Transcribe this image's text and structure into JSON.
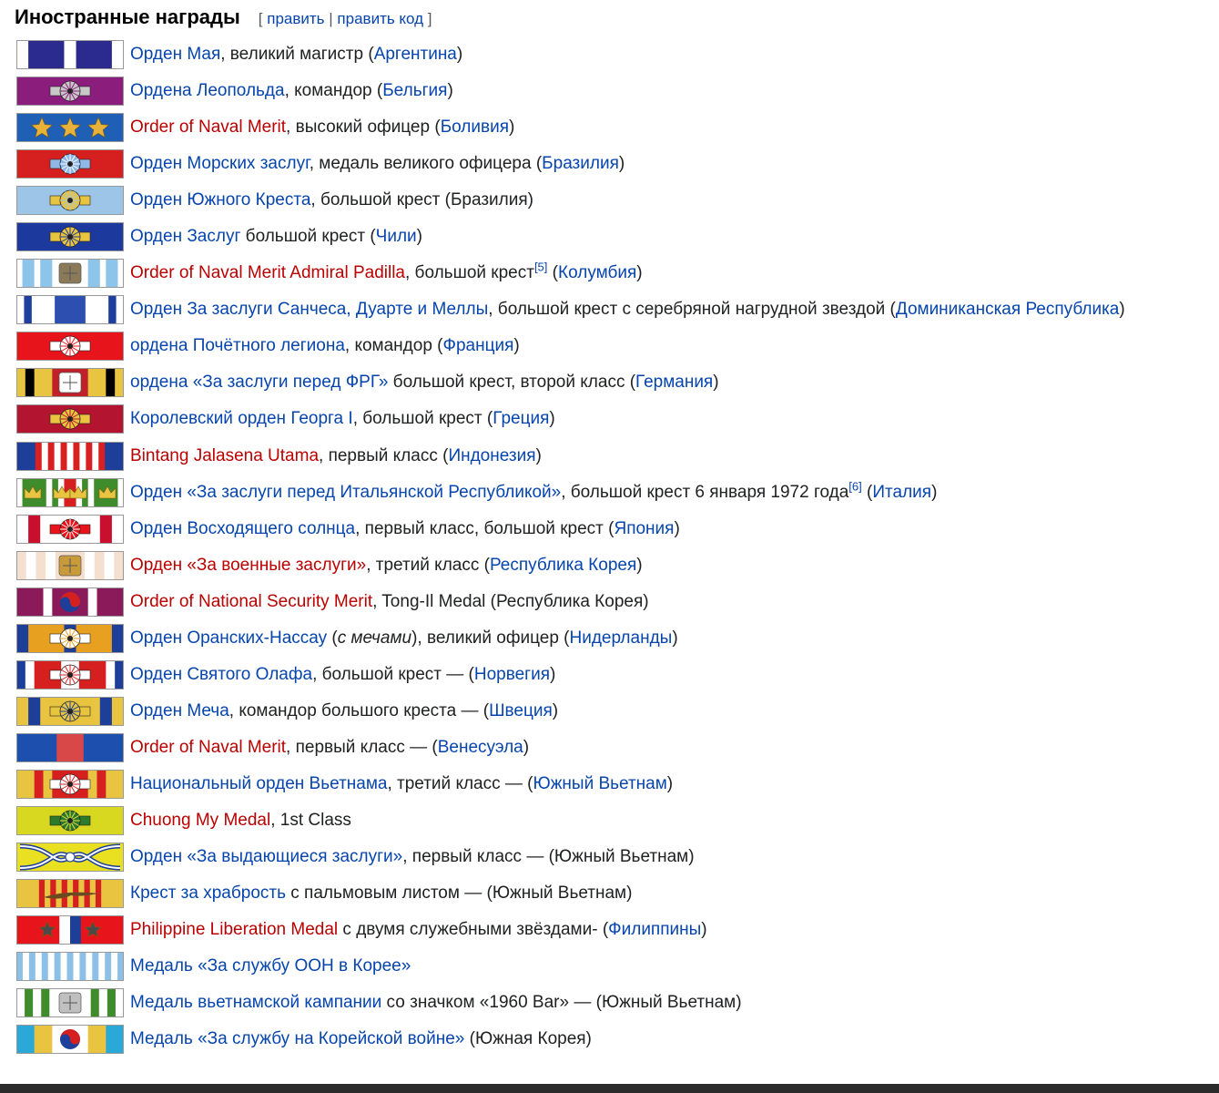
{
  "section": {
    "title": "Иностранные награды",
    "edit_open": "[",
    "edit_link": "править",
    "edit_sep": "|",
    "edit_code_link": "править код",
    "edit_close": "]"
  },
  "awards": [
    {
      "ribbon": "stripes",
      "colors": [
        "#ffffff",
        "#2b2b8f",
        "#ffffff",
        "#2b2b8f",
        "#ffffff"
      ],
      "widths": [
        1,
        3,
        1,
        3,
        1
      ],
      "parts": [
        {
          "t": "Орден Мая",
          "c": "lnk"
        },
        {
          "t": ", великий магистр (",
          "c": "txt"
        },
        {
          "t": "Аргентина",
          "c": "lnk"
        },
        {
          "t": ")",
          "c": "txt"
        }
      ]
    },
    {
      "ribbon": "rosette",
      "colors": [
        "#8b1d7d"
      ],
      "rosette": "#c8c8c8",
      "accent": "#8b1d7d",
      "parts": [
        {
          "t": "Ордена Леопольда",
          "c": "lnk"
        },
        {
          "t": ", командор (",
          "c": "txt"
        },
        {
          "t": "Бельгия",
          "c": "lnk"
        },
        {
          "t": ")",
          "c": "txt"
        }
      ]
    },
    {
      "ribbon": "stars",
      "colors": [
        "#1f5fb5"
      ],
      "star": "#e8b23a",
      "parts": [
        {
          "t": "Order of Naval Merit",
          "c": "red"
        },
        {
          "t": ", высокий офицер (",
          "c": "txt"
        },
        {
          "t": "Боливия",
          "c": "lnk"
        },
        {
          "t": ")",
          "c": "txt"
        }
      ]
    },
    {
      "ribbon": "rosette",
      "colors": [
        "#d62020"
      ],
      "rosette": "#8fb8e8",
      "accent": "#ffffff",
      "parts": [
        {
          "t": "Орден Морских заслуг",
          "c": "lnk"
        },
        {
          "t": ", медаль великого офицера (",
          "c": "txt"
        },
        {
          "t": "Бразилия",
          "c": "lnk"
        },
        {
          "t": ")",
          "c": "txt"
        }
      ]
    },
    {
      "ribbon": "rosette",
      "colors": [
        "#9cc5e8"
      ],
      "rosette": "#e8c440",
      "accent": "#9cc5e8",
      "parts": [
        {
          "t": "Орден Южного Креста",
          "c": "lnk"
        },
        {
          "t": ", большой крест (Бразилия)",
          "c": "txt"
        }
      ]
    },
    {
      "ribbon": "rosette",
      "colors": [
        "#1c3a9e"
      ],
      "rosette": "#e8c440",
      "accent": "#1c3a9e",
      "parts": [
        {
          "t": "Орден Заслуг",
          "c": "lnk"
        },
        {
          "t": " большой крест (",
          "c": "txt"
        },
        {
          "t": "Чили",
          "c": "lnk"
        },
        {
          "t": ")",
          "c": "txt"
        }
      ]
    },
    {
      "ribbon": "badge",
      "colors": [
        "#ffffff",
        "#8cc4ea",
        "#ffffff",
        "#8cc4ea",
        "#ffffff",
        "#8cc4ea",
        "#ffffff",
        "#8cc4ea",
        "#ffffff"
      ],
      "widths": [
        1,
        2,
        1,
        2,
        6,
        2,
        1,
        2,
        1
      ],
      "badge": "#8a7a5a",
      "parts": [
        {
          "t": "Order of Naval Merit Admiral Padilla",
          "c": "red"
        },
        {
          "t": ", большой крест",
          "c": "txt"
        },
        {
          "t": "[5]",
          "c": "lnk",
          "sup": true
        },
        {
          "t": " (",
          "c": "txt"
        },
        {
          "t": "Колумбия",
          "c": "lnk"
        },
        {
          "t": ")",
          "c": "txt"
        }
      ]
    },
    {
      "ribbon": "stripes",
      "colors": [
        "#ffffff",
        "#1e3f9e",
        "#ffffff",
        "#2c4fb0",
        "#ffffff",
        "#1e3f9e",
        "#ffffff"
      ],
      "widths": [
        1,
        1,
        3,
        4,
        3,
        1,
        1
      ],
      "parts": [
        {
          "t": "Орден За заслуги Санчеса, Дуарте и Меллы",
          "c": "lnk"
        },
        {
          "t": ", большой крест с серебряной нагрудной звездой (",
          "c": "txt"
        },
        {
          "t": "Доминиканская Республика",
          "c": "lnk"
        },
        {
          "t": ")",
          "c": "txt"
        }
      ]
    },
    {
      "ribbon": "rosette",
      "colors": [
        "#e8141b"
      ],
      "rosette": "#ffffff",
      "accent": "#e8141b",
      "parts": [
        {
          "t": "ордена Почётного легиона",
          "c": "lnk"
        },
        {
          "t": ", командор (",
          "c": "txt"
        },
        {
          "t": "Франция",
          "c": "lnk"
        },
        {
          "t": ")",
          "c": "txt"
        }
      ]
    },
    {
      "ribbon": "badge",
      "colors": [
        "#e8c440",
        "#000000",
        "#e8c440",
        "#c0202a",
        "#e8c440",
        "#000000",
        "#e8c440"
      ],
      "widths": [
        1,
        1,
        2,
        4,
        2,
        1,
        1
      ],
      "badge": "#ffffff",
      "parts": [
        {
          "t": "ордена «За заслуги перед ФРГ»",
          "c": "lnk"
        },
        {
          "t": " большой крест, второй класс (",
          "c": "txt"
        },
        {
          "t": "Германия",
          "c": "lnk"
        },
        {
          "t": ")",
          "c": "txt"
        }
      ]
    },
    {
      "ribbon": "rosette",
      "colors": [
        "#b3142f"
      ],
      "rosette": "#e8c440",
      "accent": "#b3142f",
      "parts": [
        {
          "t": "Королевский орден Георга I",
          "c": "lnk"
        },
        {
          "t": ", большой крест (",
          "c": "txt"
        },
        {
          "t": "Греция",
          "c": "lnk"
        },
        {
          "t": ")",
          "c": "txt"
        }
      ]
    },
    {
      "ribbon": "stripes",
      "colors": [
        "#1d3f9a",
        "#d82020",
        "#ffffff",
        "#d82020",
        "#ffffff",
        "#d82020",
        "#ffffff",
        "#d82020",
        "#ffffff",
        "#d82020",
        "#ffffff",
        "#d82020",
        "#1d3f9a"
      ],
      "widths": [
        3,
        1,
        1,
        1,
        1,
        1,
        1,
        1,
        1,
        1,
        1,
        1,
        3
      ],
      "parts": [
        {
          "t": "Bintang Jalasena Utama",
          "c": "red"
        },
        {
          "t": ", первый класс (",
          "c": "txt"
        },
        {
          "t": "Индонезия",
          "c": "lnk"
        },
        {
          "t": ")",
          "c": "txt"
        }
      ]
    },
    {
      "ribbon": "crowns",
      "colors": [
        "#ffffff",
        "#3f8c2c",
        "#ffffff",
        "#3f8c2c",
        "#ffffff",
        "#d62020",
        "#ffffff",
        "#3f8c2c",
        "#ffffff",
        "#3f8c2c",
        "#ffffff"
      ],
      "widths": [
        1,
        4,
        1,
        1,
        1,
        2,
        1,
        1,
        1,
        4,
        1
      ],
      "star": "#e8c440",
      "parts": [
        {
          "t": "Орден «За заслуги перед Итальянской Республикой»",
          "c": "lnk"
        },
        {
          "t": ", большой крест 6 января 1972 года",
          "c": "txt"
        },
        {
          "t": "[6]",
          "c": "lnk",
          "sup": true
        },
        {
          "t": " (",
          "c": "txt"
        },
        {
          "t": "Италия",
          "c": "lnk"
        },
        {
          "t": ")",
          "c": "txt"
        }
      ]
    },
    {
      "ribbon": "rosette",
      "colors": [
        "#ffffff",
        "#c8102e",
        "#ffffff",
        "#c8102e",
        "#ffffff"
      ],
      "widths": [
        1,
        1,
        5,
        1,
        1
      ],
      "rosette": "#e8141b",
      "accent": "#ffffff",
      "parts": [
        {
          "t": "Орден Восходящего солнца",
          "c": "lnk"
        },
        {
          "t": ", первый класс, большой крест (",
          "c": "txt"
        },
        {
          "t": "Япония",
          "c": "lnk"
        },
        {
          "t": ")",
          "c": "txt"
        }
      ]
    },
    {
      "ribbon": "badge",
      "colors": [
        "#f5e0d0",
        "#ffffff",
        "#f5e0d0",
        "#ffffff",
        "#f5e0d0",
        "#ffffff",
        "#f5e0d0",
        "#ffffff",
        "#f5e0d0"
      ],
      "widths": [
        1,
        1,
        1,
        1,
        3,
        1,
        1,
        1,
        1
      ],
      "badge": "#c89a3a",
      "parts": [
        {
          "t": "Орден «За военные заслуги»",
          "c": "red"
        },
        {
          "t": ", третий класс (",
          "c": "txt"
        },
        {
          "t": "Республика Корея",
          "c": "lnk"
        },
        {
          "t": ")",
          "c": "txt"
        }
      ]
    },
    {
      "ribbon": "taeguk",
      "colors": [
        "#8a1a5a",
        "#ffffff",
        "#8a1a5a",
        "#ffffff",
        "#8a1a5a"
      ],
      "widths": [
        3,
        1,
        4,
        1,
        3
      ],
      "parts": [
        {
          "t": "Order of National Security Merit",
          "c": "red"
        },
        {
          "t": ", Tong-Il Medal (Республика Корея)",
          "c": "txt"
        }
      ]
    },
    {
      "ribbon": "rosette",
      "colors": [
        "#1d3f9a",
        "#e8a020",
        "#1d3f9a",
        "#e8a020",
        "#1d3f9a"
      ],
      "widths": [
        1,
        3,
        1,
        3,
        1
      ],
      "rosette": "#ffffff",
      "accent": "#e8a020",
      "parts": [
        {
          "t": "Орден Оранских-Нассау",
          "c": "lnk"
        },
        {
          "t": " (",
          "c": "txt"
        },
        {
          "t": "с мечами",
          "c": "txt",
          "i": true
        },
        {
          "t": "), великий офицер (",
          "c": "txt"
        },
        {
          "t": "Нидерланды",
          "c": "lnk"
        },
        {
          "t": ")",
          "c": "txt"
        }
      ]
    },
    {
      "ribbon": "rosette",
      "colors": [
        "#1d3f9a",
        "#ffffff",
        "#d62020",
        "#ffffff",
        "#d62020",
        "#ffffff",
        "#1d3f9a"
      ],
      "widths": [
        1,
        1,
        3,
        2,
        3,
        1,
        1
      ],
      "rosette": "#ffffff",
      "accent": "#d62020",
      "parts": [
        {
          "t": "Орден Святого Олафа",
          "c": "lnk"
        },
        {
          "t": ", большой крест — (",
          "c": "txt"
        },
        {
          "t": "Норвегия",
          "c": "lnk"
        },
        {
          "t": ")",
          "c": "txt"
        }
      ]
    },
    {
      "ribbon": "rosette",
      "colors": [
        "#e8c440",
        "#1d3f9a",
        "#e8c440",
        "#1d3f9a",
        "#e8c440"
      ],
      "widths": [
        1,
        1,
        5,
        1,
        1
      ],
      "rosette": "#e8c440",
      "accent": "#1d3f9a",
      "parts": [
        {
          "t": "Орден Меча",
          "c": "lnk"
        },
        {
          "t": ", командор большого креста — (",
          "c": "txt"
        },
        {
          "t": "Швеция",
          "c": "lnk"
        },
        {
          "t": ")",
          "c": "txt"
        }
      ]
    },
    {
      "ribbon": "stripes",
      "colors": [
        "#1d4fae",
        "#d84848",
        "#1d4fae"
      ],
      "widths": [
        3,
        2,
        3
      ],
      "parts": [
        {
          "t": "Order of Naval Merit",
          "c": "red"
        },
        {
          "t": ", первый класс — (",
          "c": "txt"
        },
        {
          "t": "Венесуэла",
          "c": "lnk"
        },
        {
          "t": ")",
          "c": "txt"
        }
      ]
    },
    {
      "ribbon": "rosette",
      "colors": [
        "#e8c440",
        "#d62020",
        "#e8c440",
        "#d62020",
        "#e8c440",
        "#d62020",
        "#e8c440"
      ],
      "widths": [
        2,
        1,
        1,
        4,
        1,
        1,
        2
      ],
      "rosette": "#ffffff",
      "accent": "#d62020",
      "parts": [
        {
          "t": "Национальный орден Вьетнама",
          "c": "lnk"
        },
        {
          "t": ", третий класс — (",
          "c": "txt"
        },
        {
          "t": "Южный Вьетнам",
          "c": "lnk"
        },
        {
          "t": ")",
          "c": "txt"
        }
      ]
    },
    {
      "ribbon": "rosette",
      "colors": [
        "#d8d820"
      ],
      "rosette": "#2c7a2c",
      "accent": "#e8e040",
      "parts": [
        {
          "t": "Chuong My Medal",
          "c": "red"
        },
        {
          "t": ", 1st Class",
          "c": "txt"
        }
      ]
    },
    {
      "ribbon": "wave",
      "colors": [
        "#e8e020"
      ],
      "star": "#1d3f9a",
      "parts": [
        {
          "t": "Орден «За выдающиеся заслуги»",
          "c": "lnk"
        },
        {
          "t": ", первый класс — (Южный Вьетнам)",
          "c": "txt"
        }
      ]
    },
    {
      "ribbon": "palm",
      "colors": [
        "#e8c440",
        "#d62020",
        "#e8c440",
        "#d62020",
        "#e8c440",
        "#d62020",
        "#e8c440",
        "#d62020",
        "#e8c440",
        "#d62020",
        "#e8c440",
        "#d62020",
        "#e8c440"
      ],
      "widths": [
        4,
        1,
        1,
        1,
        1,
        1,
        1,
        1,
        1,
        1,
        1,
        1,
        4
      ],
      "star": "#6a4a20",
      "parts": [
        {
          "t": "Крест за храбрость",
          "c": "lnk"
        },
        {
          "t": " с пальмовым листом — (Южный Вьетнам)",
          "c": "txt"
        }
      ]
    },
    {
      "ribbon": "stars2",
      "colors": [
        "#e8141b",
        "#ffffff",
        "#1d3f9a",
        "#e8141b"
      ],
      "widths": [
        4,
        1,
        1,
        4
      ],
      "star": "#4a4a4a",
      "parts": [
        {
          "t": "Philippine Liberation Medal",
          "c": "red"
        },
        {
          "t": " с двумя служебными звёздами- (",
          "c": "txt"
        },
        {
          "t": "Филиппины",
          "c": "lnk"
        },
        {
          "t": ")",
          "c": "txt"
        }
      ]
    },
    {
      "ribbon": "stripes",
      "colors": [
        "#8cc0e6",
        "#ffffff",
        "#8cc0e6",
        "#ffffff",
        "#8cc0e6",
        "#ffffff",
        "#8cc0e6",
        "#ffffff",
        "#8cc0e6",
        "#ffffff",
        "#8cc0e6",
        "#ffffff",
        "#8cc0e6",
        "#ffffff",
        "#8cc0e6",
        "#ffffff",
        "#8cc0e6"
      ],
      "widths": [
        1,
        1,
        1,
        1,
        1,
        1,
        1,
        1,
        1,
        1,
        1,
        1,
        1,
        1,
        1,
        1,
        1
      ],
      "parts": [
        {
          "t": "Медаль «За службу ООН в Корее»",
          "c": "lnk"
        }
      ]
    },
    {
      "ribbon": "badge",
      "colors": [
        "#ffffff",
        "#3f8c2c",
        "#ffffff",
        "#3f8c2c",
        "#ffffff",
        "#3f8c2c",
        "#ffffff",
        "#3f8c2c",
        "#ffffff"
      ],
      "widths": [
        1,
        1,
        1,
        1,
        5,
        1,
        1,
        1,
        1
      ],
      "badge": "#c0c0c0",
      "parts": [
        {
          "t": "Медаль вьетнамской кампании",
          "c": "lnk"
        },
        {
          "t": " со значком «1960 Bar» — (Южный Вьетнам)",
          "c": "txt"
        }
      ]
    },
    {
      "ribbon": "taeguk",
      "colors": [
        "#2aa8d8",
        "#e8c440",
        "#ffffff",
        "#e8c440",
        "#2aa8d8"
      ],
      "widths": [
        2,
        2,
        4,
        2,
        2
      ],
      "parts": [
        {
          "t": "Медаль «За службу на Корейской войне»",
          "c": "lnk"
        },
        {
          "t": " (Южная Корея)",
          "c": "txt"
        }
      ]
    }
  ]
}
